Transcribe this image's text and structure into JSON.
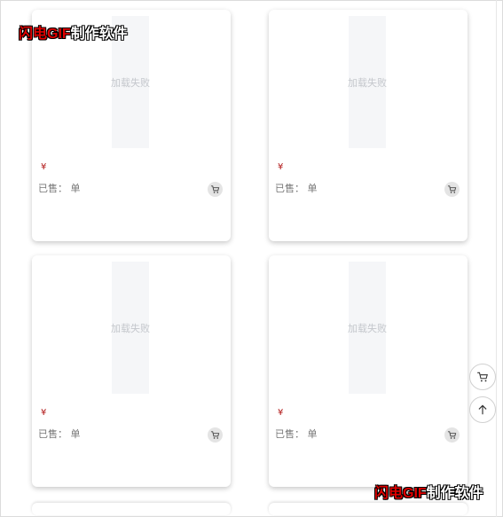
{
  "products": [
    {
      "image_text": "加载失败",
      "price": "¥",
      "sold": "已售：  单"
    },
    {
      "image_text": "加载失败",
      "price": "¥",
      "sold": "已售：  单"
    },
    {
      "image_text": "加载失败",
      "price": "¥",
      "sold": "已售：  单"
    },
    {
      "image_text": "加载失败",
      "price": "¥",
      "sold": "已售：  单"
    }
  ],
  "icons": {
    "card_cart": "cart-icon",
    "float_cart": "cart-icon",
    "float_top": "arrow-up-icon"
  },
  "watermark": {
    "red_part": "闪电GIF",
    "white_part": "制作软件"
  },
  "colors": {
    "price": "#b01515",
    "placeholder_bg": "#f5f6f8",
    "placeholder_text": "#c4c7cc",
    "watermark_red": "#e00000"
  }
}
